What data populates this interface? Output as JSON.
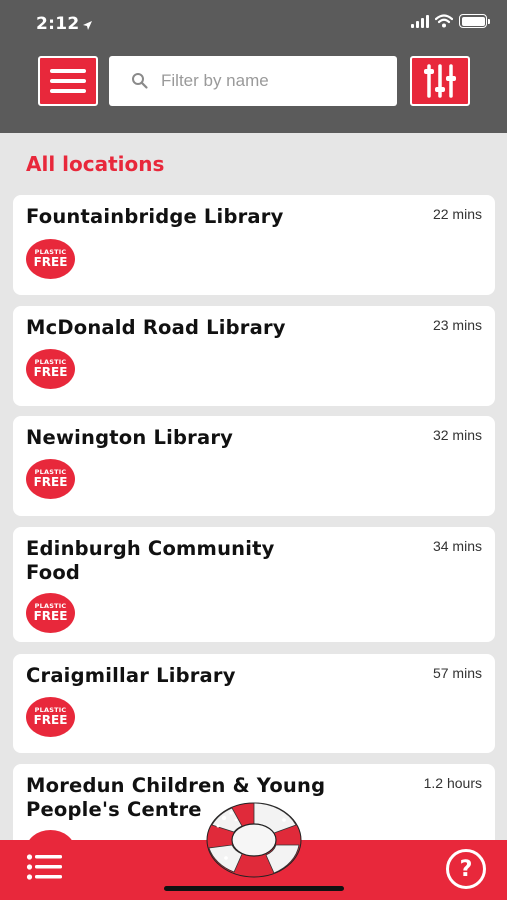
{
  "status": {
    "time": "2:12"
  },
  "search": {
    "placeholder": "Filter by name",
    "value": ""
  },
  "section_title": "All locations",
  "badge": {
    "top": "PLASTIC",
    "bottom": "FREE"
  },
  "locations": [
    {
      "name": "Fountainbridge Library",
      "time": "22 mins"
    },
    {
      "name": "McDonald Road Library",
      "time": "23 mins"
    },
    {
      "name": "Newington Library",
      "time": "32 mins"
    },
    {
      "name": "Edinburgh Community Food",
      "time": "34 mins"
    },
    {
      "name": "Craigmillar Library",
      "time": "57 mins"
    },
    {
      "name": "Moredun Children & Young People's Centre",
      "time": "1.2 hours"
    }
  ],
  "icons": {
    "menu": "hamburger-menu-icon",
    "search": "search-icon",
    "filter": "sliders-filter-icon",
    "list": "list-icon",
    "help": "question-mark-icon",
    "center": "lifebuoy-icon"
  },
  "colors": {
    "accent": "#e8283b",
    "header": "#5b5b5b",
    "background": "#e6e6e6"
  }
}
